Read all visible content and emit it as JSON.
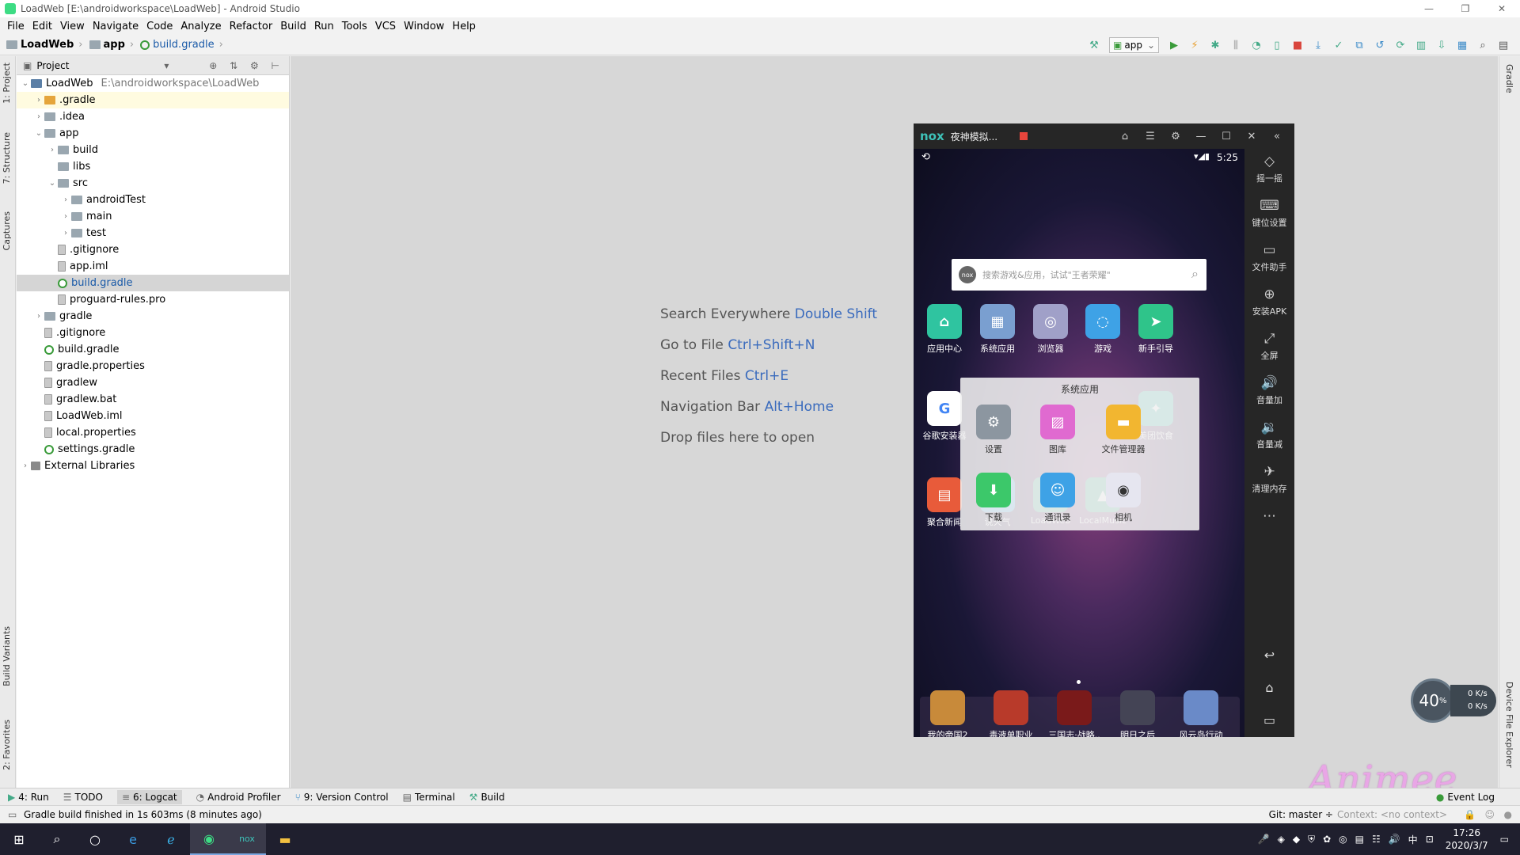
{
  "window": {
    "title": "LoadWeb [E:\\androidworkspace\\LoadWeb] - Android Studio",
    "min": "—",
    "max": "❐",
    "close": "✕"
  },
  "menu": [
    "File",
    "Edit",
    "View",
    "Navigate",
    "Code",
    "Analyze",
    "Refactor",
    "Build",
    "Run",
    "Tools",
    "VCS",
    "Window",
    "Help"
  ],
  "breadcrumb": {
    "project": "LoadWeb",
    "module": "app",
    "file": "build.gradle"
  },
  "toolbar": {
    "run_config": "app"
  },
  "left_tabs": {
    "project": "1: Project",
    "structure": "7: Structure",
    "captures": "Captures",
    "build_variants": "Build Variants",
    "favorites": "2: Favorites"
  },
  "right_tabs": {
    "gradle": "Gradle",
    "device_explorer": "Device File Explorer"
  },
  "project_panel": {
    "header": "Project",
    "tree": [
      {
        "label": "LoadWeb",
        "path": "E:\\androidworkspace\\LoadWeb",
        "depth": 0,
        "arrow": "⌄",
        "icon": "module"
      },
      {
        "label": ".gradle",
        "depth": 1,
        "arrow": "›",
        "icon": "orange",
        "hl": true
      },
      {
        "label": ".idea",
        "depth": 1,
        "arrow": "›",
        "icon": "folder"
      },
      {
        "label": "app",
        "depth": 1,
        "arrow": "⌄",
        "icon": "folder"
      },
      {
        "label": "build",
        "depth": 2,
        "arrow": "›",
        "icon": "folder"
      },
      {
        "label": "libs",
        "depth": 2,
        "arrow": "",
        "icon": "folder"
      },
      {
        "label": "src",
        "depth": 2,
        "arrow": "⌄",
        "icon": "folder"
      },
      {
        "label": "androidTest",
        "depth": 3,
        "arrow": "›",
        "icon": "folder"
      },
      {
        "label": "main",
        "depth": 3,
        "arrow": "›",
        "icon": "folder"
      },
      {
        "label": "test",
        "depth": 3,
        "arrow": "›",
        "icon": "folder"
      },
      {
        "label": ".gitignore",
        "depth": 2,
        "arrow": "",
        "icon": "file"
      },
      {
        "label": "app.iml",
        "depth": 2,
        "arrow": "",
        "icon": "file"
      },
      {
        "label": "build.gradle",
        "depth": 2,
        "arrow": "",
        "icon": "gradle",
        "sel": true
      },
      {
        "label": "proguard-rules.pro",
        "depth": 2,
        "arrow": "",
        "icon": "file"
      },
      {
        "label": "gradle",
        "depth": 1,
        "arrow": "›",
        "icon": "folder"
      },
      {
        "label": ".gitignore",
        "depth": 1,
        "arrow": "",
        "icon": "file"
      },
      {
        "label": "build.gradle",
        "depth": 1,
        "arrow": "",
        "icon": "gradle"
      },
      {
        "label": "gradle.properties",
        "depth": 1,
        "arrow": "",
        "icon": "file"
      },
      {
        "label": "gradlew",
        "depth": 1,
        "arrow": "",
        "icon": "file"
      },
      {
        "label": "gradlew.bat",
        "depth": 1,
        "arrow": "",
        "icon": "file"
      },
      {
        "label": "LoadWeb.iml",
        "depth": 1,
        "arrow": "",
        "icon": "file"
      },
      {
        "label": "local.properties",
        "depth": 1,
        "arrow": "",
        "icon": "file"
      },
      {
        "label": "settings.gradle",
        "depth": 1,
        "arrow": "",
        "icon": "gradle"
      },
      {
        "label": "External Libraries",
        "depth": 0,
        "arrow": "›",
        "icon": "lib"
      }
    ]
  },
  "editor_hints": [
    {
      "text": "Search Everywhere ",
      "key": "Double Shift"
    },
    {
      "text": "Go to File ",
      "key": "Ctrl+Shift+N"
    },
    {
      "text": "Recent Files ",
      "key": "Ctrl+E"
    },
    {
      "text": "Navigation Bar ",
      "key": "Alt+Home"
    },
    {
      "text": "Drop files here to open",
      "key": ""
    }
  ],
  "emulator": {
    "logo": "nox",
    "name": "夜神模拟...",
    "time": "5:25",
    "search_placeholder": "搜索游戏&应用，试试\"王者荣耀\"",
    "home_apps": [
      {
        "label": "应用中心",
        "color": "#2fc4a0",
        "glyph": "⌂"
      },
      {
        "label": "系统应用",
        "color": "#7a9fd0",
        "glyph": "▦"
      },
      {
        "label": "浏览器",
        "color": "#a0a0c8",
        "glyph": "◎"
      },
      {
        "label": "游戏",
        "color": "#3ea2e6",
        "glyph": "◌"
      },
      {
        "label": "新手引导",
        "color": "#2fc48a",
        "glyph": "➤"
      },
      {
        "label": "谷歌安装器",
        "color": "#ffffff",
        "glyph": "G"
      },
      {
        "label": "美团饮食",
        "color": "#2ab3a0",
        "glyph": "✦"
      },
      {
        "label": "聚合新闻",
        "color": "#e85b3a",
        "glyph": "▤"
      },
      {
        "label": "说天气",
        "color": "#3ea2e6",
        "glyph": "☁"
      },
      {
        "label": "LoadWeb",
        "color": "#3aa88c",
        "glyph": "▲"
      },
      {
        "label": "LocalMusic",
        "color": "#3aa88c",
        "glyph": "▲"
      }
    ],
    "folder": {
      "title": "系统应用",
      "items": [
        {
          "label": "设置",
          "color": "#8c96a0",
          "glyph": "⚙"
        },
        {
          "label": "图库",
          "color": "#e06ad0",
          "glyph": "▨"
        },
        {
          "label": "文件管理器",
          "color": "#f2b630",
          "glyph": "▬"
        },
        {
          "label": "下载",
          "color": "#3cc86a",
          "glyph": "⬇"
        },
        {
          "label": "通讯录",
          "color": "#3ea2e6",
          "glyph": "☺"
        },
        {
          "label": "相机",
          "color": "#e6e6f0",
          "glyph": "◉"
        }
      ]
    },
    "dock": [
      {
        "label": "我的帝国2",
        "color": "#c88a3a"
      },
      {
        "label": "毒液单职业",
        "color": "#b83a2a"
      },
      {
        "label": "三国志·战略..",
        "color": "#7a1a1a"
      },
      {
        "label": "明日之后",
        "color": "#444455"
      },
      {
        "label": "风云岛行动",
        "color": "#6a8ac8"
      }
    ],
    "side": [
      {
        "label": "摇一摇",
        "glyph": "◇"
      },
      {
        "label": "键位设置",
        "glyph": "⌨"
      },
      {
        "label": "文件助手",
        "glyph": "▭"
      },
      {
        "label": "安装APK",
        "glyph": "⊕"
      },
      {
        "label": "全屏",
        "glyph": "⤢"
      },
      {
        "label": "音量加",
        "glyph": "🔊"
      },
      {
        "label": "音量减",
        "glyph": "🔉"
      },
      {
        "label": "清理内存",
        "glyph": "✈"
      },
      {
        "label": "",
        "glyph": "⋯"
      }
    ],
    "nav": [
      "↩",
      "⌂",
      "▭"
    ]
  },
  "speed": {
    "percent": "40",
    "up": "0 K/s",
    "down": "0 K/s"
  },
  "watermark": "Animee",
  "bottom_tabs": [
    "4: Run",
    "TODO",
    "6: Logcat",
    "Android Profiler",
    "9: Version Control",
    "Terminal",
    "Build"
  ],
  "event_log": "Event Log",
  "status": {
    "message": "Gradle build finished in 1s 603ms (8 minutes ago)",
    "git": "Git: master ÷",
    "context": "Context: <no context>"
  },
  "taskbar": {
    "time": "17:26",
    "date": "2020/3/7"
  },
  "colors": {
    "editor_bg": "#d7d7d7",
    "key_blue": "#3a6bbd",
    "nox_teal": "#3ec3b9"
  }
}
